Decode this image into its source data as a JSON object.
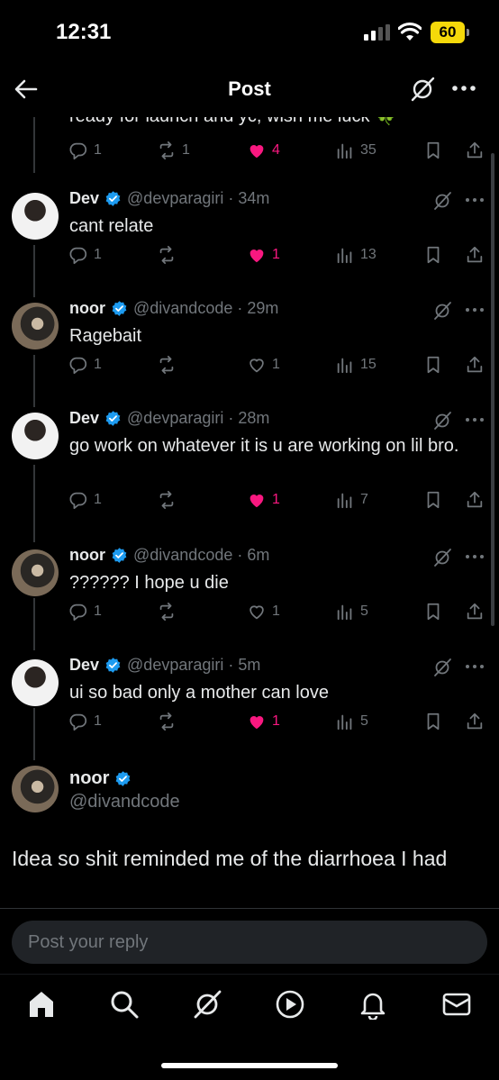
{
  "status_bar": {
    "time": "12:31",
    "battery": "60"
  },
  "header": {
    "title": "Post"
  },
  "partial_text": "ready for launch and yc, wish me luck 🍀",
  "partial_stats": {
    "replies": "1",
    "reposts": "1",
    "likes": "4",
    "views": "35"
  },
  "replies": [
    {
      "name": "Dev",
      "handle": "@devparagiri · 34m",
      "text": "cant relate",
      "replies": "1",
      "reposts": "",
      "likes": "1",
      "liked": true,
      "views": "13"
    },
    {
      "name": "noor",
      "handle": "@divandcode · 29m",
      "text": "Ragebait",
      "replies": "1",
      "reposts": "",
      "likes": "1",
      "liked": false,
      "views": "15"
    },
    {
      "name": "Dev",
      "handle": "@devparagiri · 28m",
      "text": "go work on whatever it is u are working on lil bro.",
      "replies": "1",
      "reposts": "",
      "likes": "1",
      "liked": true,
      "views": "7"
    },
    {
      "name": "noor",
      "handle": "@divandcode · 6m",
      "text": "?????? I hope u die",
      "replies": "1",
      "reposts": "",
      "likes": "1",
      "liked": false,
      "views": "5"
    },
    {
      "name": "Dev",
      "handle": "@devparagiri · 5m",
      "text": "ui so bad only a mother can love",
      "replies": "1",
      "reposts": "",
      "likes": "1",
      "liked": true,
      "views": "5"
    }
  ],
  "main_post": {
    "name": "noor",
    "handle": "@divandcode",
    "text": "Idea so shit reminded me of the diarrhoea I had"
  },
  "composer": {
    "placeholder": "Post your reply"
  },
  "tabs": [
    "home-icon",
    "search-icon",
    "grok-icon",
    "video-icon",
    "notifications-icon",
    "messages-icon"
  ],
  "colors": {
    "like": "#f91880",
    "verified": "#1d9bf0",
    "muted": "#71767b",
    "battery": "#f5d90a"
  }
}
